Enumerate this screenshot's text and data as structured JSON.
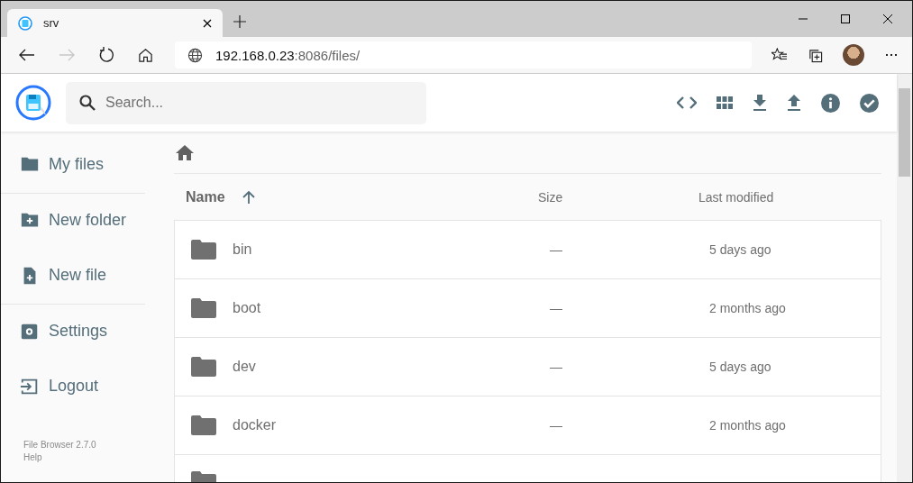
{
  "browser": {
    "tab": {
      "title": "srv"
    },
    "address": {
      "host": "192.168.0.23",
      "rest": ":8086/files/"
    }
  },
  "header": {
    "search": {
      "placeholder": "Search..."
    }
  },
  "sidebar": {
    "items": [
      {
        "label": "My files",
        "kind": "folder",
        "divider_after": true
      },
      {
        "label": "New folder",
        "kind": "newfolder",
        "divider_after": false
      },
      {
        "label": "New file",
        "kind": "newfile",
        "divider_after": true
      },
      {
        "label": "Settings",
        "kind": "settings",
        "divider_after": false
      },
      {
        "label": "Logout",
        "kind": "logout",
        "divider_after": false
      }
    ],
    "footer": [
      "File Browser 2.7.0",
      "Help"
    ]
  },
  "table": {
    "columns": [
      {
        "label": "Name",
        "sorted": true
      },
      {
        "label": "Size",
        "sorted": false
      },
      {
        "label": "Last modified",
        "sorted": false
      }
    ],
    "rows": [
      {
        "name": "bin",
        "size": "—",
        "modified": "5 days ago"
      },
      {
        "name": "boot",
        "size": "—",
        "modified": "2 months ago"
      },
      {
        "name": "dev",
        "size": "—",
        "modified": "5 days ago"
      },
      {
        "name": "docker",
        "size": "—",
        "modified": "2 months ago"
      },
      {
        "kind": "cut"
      }
    ]
  }
}
